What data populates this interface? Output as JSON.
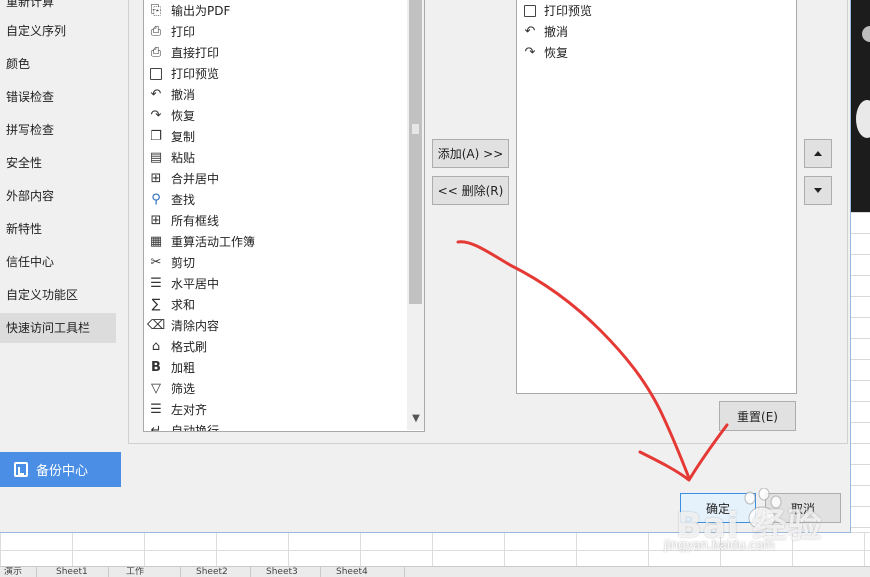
{
  "nav": {
    "items": [
      {
        "label": "重新计算",
        "active": false
      },
      {
        "label": "自定义序列",
        "active": false
      },
      {
        "label": "颜色",
        "active": false
      },
      {
        "label": "错误检查",
        "active": false
      },
      {
        "label": "拼写检查",
        "active": false
      },
      {
        "label": "安全性",
        "active": false
      },
      {
        "label": "外部内容",
        "active": false
      },
      {
        "label": "新特性",
        "active": false
      },
      {
        "label": "信任中心",
        "active": false
      },
      {
        "label": "自定义功能区",
        "active": false
      },
      {
        "label": "快速访问工具栏",
        "active": true
      }
    ],
    "backup_label": "备份中心"
  },
  "commands": [
    {
      "label": "输出为PDF",
      "icon": "pdf-export-icon"
    },
    {
      "label": "打印",
      "icon": "print-icon"
    },
    {
      "label": "直接打印",
      "icon": "direct-print-icon"
    },
    {
      "label": "打印预览",
      "icon": "print-preview-icon"
    },
    {
      "label": "撤消",
      "icon": "undo-icon"
    },
    {
      "label": "恢复",
      "icon": "redo-icon"
    },
    {
      "label": "复制",
      "icon": "copy-icon"
    },
    {
      "label": "粘贴",
      "icon": "paste-icon"
    },
    {
      "label": "合并居中",
      "icon": "merge-center-icon"
    },
    {
      "label": "查找",
      "icon": "find-icon"
    },
    {
      "label": "所有框线",
      "icon": "all-borders-icon"
    },
    {
      "label": "重算活动工作簿",
      "icon": "recalc-workbook-icon"
    },
    {
      "label": "剪切",
      "icon": "cut-icon"
    },
    {
      "label": "水平居中",
      "icon": "center-align-icon"
    },
    {
      "label": "求和",
      "icon": "sum-icon"
    },
    {
      "label": "清除内容",
      "icon": "clear-content-icon"
    },
    {
      "label": "格式刷",
      "icon": "format-painter-icon"
    },
    {
      "label": "加粗",
      "icon": "bold-icon"
    },
    {
      "label": "筛选",
      "icon": "filter-icon"
    },
    {
      "label": "左对齐",
      "icon": "left-align-icon"
    },
    {
      "label": "自动换行",
      "icon": "wrap-text-icon"
    }
  ],
  "quick_access": [
    {
      "label": "打印预览",
      "icon": "print-preview-icon"
    },
    {
      "label": "撤消",
      "icon": "undo-icon"
    },
    {
      "label": "恢复",
      "icon": "redo-icon"
    }
  ],
  "buttons": {
    "add": "添加(A) >>",
    "remove": "<< 删除(R)",
    "reset": "重置(E)",
    "ok": "确定",
    "cancel": "取消"
  },
  "sheet_tabs": [
    "演示",
    "Sheet1",
    "工作",
    "Sheet2",
    "Sheet3",
    "Sheet4"
  ],
  "watermark": {
    "text": "Bai 经验",
    "url": "jingyan.baidu.com"
  },
  "colors": {
    "accent": "#4a8ee6",
    "annotation": "#e53935"
  }
}
